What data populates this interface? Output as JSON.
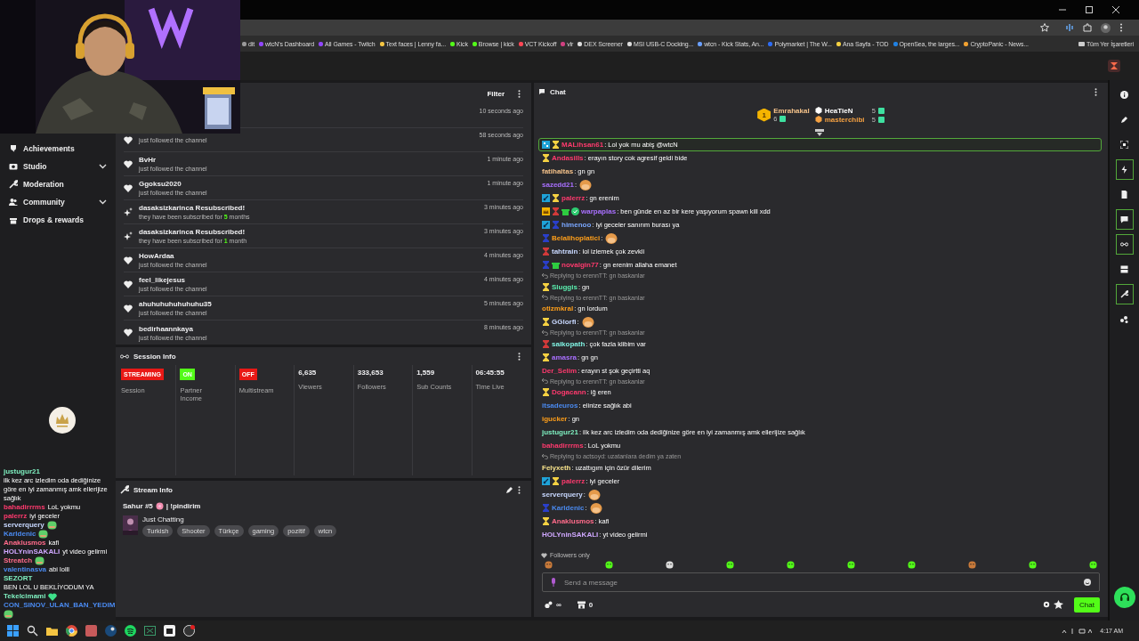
{
  "browser": {
    "bookmarks": [
      {
        "label": "dit",
        "color": "#9a9a9a"
      },
      {
        "label": "wtcN's Dashboard",
        "color": "#9146ff"
      },
      {
        "label": "All Games - Twitch",
        "color": "#9146ff"
      },
      {
        "label": "Text faces | Lenny fa...",
        "color": "#f5c542"
      },
      {
        "label": "Kick",
        "color": "#53fc18"
      },
      {
        "label": "Browse | kick",
        "color": "#53fc18"
      },
      {
        "label": "VCT Kickoff",
        "color": "#ff4655"
      },
      {
        "label": "vlr",
        "color": "#d04080"
      },
      {
        "label": "DEX Screener",
        "color": "#dddddd"
      },
      {
        "label": "MSI USB-C Docking...",
        "color": "#dddddd"
      },
      {
        "label": "wtcn - Kick Stats, An...",
        "color": "#6aa0ff"
      },
      {
        "label": "Polymarket | The W...",
        "color": "#2d6cf5"
      },
      {
        "label": "Ana Sayfa - TOD",
        "color": "#f5d142"
      },
      {
        "label": "OpenSea, the larges...",
        "color": "#2081e2"
      },
      {
        "label": "CryptoPanic - News...",
        "color": "#f0a030"
      }
    ],
    "all_bookmarks": "Tüm Yer İşaretleri"
  },
  "sidebar": {
    "items": [
      {
        "label": "Achievements",
        "kind": "trophy",
        "has_submenu": false
      },
      {
        "label": "Studio",
        "kind": "camera",
        "has_submenu": true
      },
      {
        "label": "Moderation",
        "kind": "wrench",
        "has_submenu": false
      },
      {
        "label": "Community",
        "kind": "people",
        "has_submenu": true
      },
      {
        "label": "Drops & rewards",
        "kind": "gift",
        "has_submenu": false
      }
    ]
  },
  "activity_feed": {
    "filter": "Filter",
    "items": [
      {
        "time": "10 seconds ago"
      },
      {
        "kind": "follow",
        "detail": "just followed the channel",
        "time": "58 seconds ago"
      },
      {
        "kind": "follow",
        "name": "BvHr",
        "detail": "just followed the channel",
        "time": "1 minute ago"
      },
      {
        "kind": "follow",
        "name": "Ggoksu2020",
        "detail": "just followed the channel",
        "time": "1 minute ago"
      },
      {
        "kind": "resub",
        "name": "dasaksizkarinca Resubscribed!",
        "detail": "they have been subscribed for",
        "count": "5",
        "unit": "months",
        "time": "3 minutes ago"
      },
      {
        "kind": "resub",
        "name": "dasaksizkarinca Resubscribed!",
        "detail": "they have been subscribed for",
        "count": "1",
        "unit": "month",
        "time": "3 minutes ago"
      },
      {
        "kind": "follow",
        "name": "HowArdaa",
        "detail": "just followed the channel",
        "time": "4 minutes ago"
      },
      {
        "kind": "follow",
        "name": "feel_likejesus",
        "detail": "just followed the channel",
        "time": "4 minutes ago"
      },
      {
        "kind": "follow",
        "name": "ahuhuhuhuhuhuhu35",
        "detail": "just followed the channel",
        "time": "5 minutes ago"
      },
      {
        "kind": "follow",
        "name": "bedirhaannkaya",
        "detail": "just followed the channel",
        "time": "8 minutes ago"
      }
    ]
  },
  "session_info": {
    "title": "Session Info",
    "cells": [
      {
        "kind": "status",
        "badge": "STREAMING",
        "color": "#e91916",
        "label": "Session"
      },
      {
        "kind": "status",
        "badge": "ON",
        "color": "#53fc18",
        "label": "Partner Income"
      },
      {
        "kind": "status",
        "badge": "OFF",
        "color": "#e91916",
        "label": "Multistream"
      },
      {
        "kind": "stat",
        "value": "6,635",
        "label": "Viewers"
      },
      {
        "kind": "stat",
        "value": "333,653",
        "label": "Followers"
      },
      {
        "kind": "stat",
        "value": "1,559",
        "label": "Sub Counts"
      },
      {
        "kind": "stat",
        "value": "06:45:55",
        "label": "Time Live"
      }
    ]
  },
  "stream_info": {
    "title": "Stream Info",
    "stream_title": "Sahur #5",
    "command": "| !pindirim",
    "category": "Just Chatting",
    "tags": [
      "Turkish",
      "Shooter",
      "Türkçe",
      "gaming",
      "pozitif",
      "wtcn"
    ]
  },
  "chat": {
    "title": "Chat",
    "leaderboard": {
      "top": {
        "rank": "1",
        "user": "Emrahakal",
        "count": "6",
        "color": "#f5c28a"
      },
      "others": [
        {
          "user": "HeaTieN",
          "count": "5",
          "color": "#ffffff"
        },
        {
          "user": "masterchibi",
          "count": "5",
          "color": "#f5a142"
        }
      ]
    },
    "messages": [
      {
        "badges": [
          {
            "kind": "grid"
          },
          {
            "kind": "sub"
          }
        ],
        "user": "MALihsan61",
        "color": "#ff3a6e",
        "kind": "text",
        "text": ": Lol yok mu abiş @wtcN",
        "highlighted": true
      },
      {
        "badges": [
          {
            "kind": "sub"
          }
        ],
        "user": "Andasills",
        "color": "#ff3a6e",
        "kind": "text",
        "text": ": erayın story cok agresif geldi bide",
        "highlighted": false
      },
      {
        "user": "fatihaltas",
        "color": "#f5c28a",
        "kind": "text",
        "text": ": gn gn",
        "highlighted": false
      },
      {
        "user": "sazedd21",
        "color": "#a970ff",
        "kind": "emote",
        "text": ":",
        "highlighted": false
      },
      {
        "badges": [
          {
            "kind": "mod"
          },
          {
            "kind": "sub"
          }
        ],
        "user": "palerrz",
        "color": "#ff3a6e",
        "kind": "text",
        "text": ": gn erenim",
        "highlighted": false
      },
      {
        "badges": [
          {
            "kind": "crown"
          },
          {
            "kind": "sub-red"
          },
          {
            "kind": "gift"
          },
          {
            "kind": "verified"
          }
        ],
        "user": "warpaplas",
        "color": "#a970ff",
        "kind": "text",
        "text": ": ben günde en az bir kere yaşıyorum spawn kill xdd",
        "highlighted": false
      },
      {
        "badges": [
          {
            "kind": "mod"
          },
          {
            "kind": "sub-blue"
          }
        ],
        "user": "himenoo",
        "color": "#7aa7ff",
        "kind": "text",
        "text": ": iyi geceler sanırım burası ya",
        "highlighted": false
      },
      {
        "badges": [
          {
            "kind": "sub-blue"
          }
        ],
        "user": "Belalihoplatici",
        "color": "#ff9f1a",
        "kind": "emote",
        "text": ":",
        "highlighted": false
      },
      {
        "badges": [
          {
            "kind": "sub-red"
          }
        ],
        "user": "tahtrain",
        "color": "#c8d8ff",
        "kind": "text",
        "text": ": lol izlemek çok zevkli",
        "highlighted": false
      },
      {
        "badges": [
          {
            "kind": "sub-blue"
          },
          {
            "kind": "gift"
          }
        ],
        "user": "novalgin77",
        "color": "#ff3a6e",
        "kind": "text",
        "text": ": gn erenim allaha emanet",
        "highlighted": false
      },
      {
        "reply": "Replying to erennTT: gn baskanlar",
        "badges": [
          {
            "kind": "sub"
          }
        ],
        "user": "Sluggis",
        "color": "#5bf0b0",
        "kind": "text",
        "text": ": gn",
        "highlighted": false
      },
      {
        "reply": "Replying to erennTT: gn baskanlar",
        "user": "otizmkral",
        "color": "#ff9f1a",
        "kind": "text",
        "text": ": gn lordum",
        "highlighted": false
      },
      {
        "badges": [
          {
            "kind": "sub"
          }
        ],
        "user": "GGlorfi",
        "color": "#c8d8ff",
        "kind": "emote",
        "text": ":",
        "highlighted": false
      },
      {
        "reply": "Replying to erennTT: gn baskanlar",
        "badges": [
          {
            "kind": "sub-red"
          }
        ],
        "user": "saikopath",
        "color": "#7ff0e0",
        "kind": "text",
        "text": ": çok fazla klibim var",
        "highlighted": false
      },
      {
        "badges": [
          {
            "kind": "sub"
          }
        ],
        "user": "amasra",
        "color": "#a970ff",
        "kind": "text",
        "text": ": gn gn",
        "highlighted": false
      },
      {
        "user": "Der_Selim",
        "color": "#ff3a6e",
        "kind": "text",
        "text": ": erayın st şok geçirtti aq",
        "highlighted": false
      },
      {
        "reply": "Replying to erennTT: gn baskanlar",
        "badges": [
          {
            "kind": "sub"
          }
        ],
        "user": "Dogacann",
        "color": "#ff3a6e",
        "kind": "text",
        "text": ": iğ eren",
        "highlighted": false
      },
      {
        "user": "itsadeuros",
        "color": "#4a8af0",
        "kind": "text",
        "text": ": elinize sağlık abi",
        "highlighted": false
      },
      {
        "user": "igucker",
        "color": "#ff9f1a",
        "kind": "text",
        "text": ": gn",
        "highlighted": false
      },
      {
        "user": "justugur21",
        "color": "#7ff0c0",
        "kind": "text",
        "text": ": ilk kez arc izledim oda dediğinize göre en iyi zamanmış amk ellerijize sağlık",
        "highlighted": false
      },
      {
        "user": "bahadirrrms",
        "color": "#ff3a6e",
        "kind": "text",
        "text": ": LoL yokmu",
        "highlighted": false
      },
      {
        "reply": "Replying to actsoyd: uzatanlara dedim ya zaten",
        "user": "Felyxeth",
        "color": "#f5e08a",
        "kind": "text",
        "text": ": uzattıgım için özür dilerim",
        "highlighted": false
      },
      {
        "badges": [
          {
            "kind": "mod"
          },
          {
            "kind": "sub"
          }
        ],
        "user": "palerrz",
        "color": "#ff3a6e",
        "kind": "text",
        "text": ": iyi geceler",
        "highlighted": false
      },
      {
        "user": "serverquery",
        "color": "#c8d8ff",
        "kind": "emote",
        "text": ":",
        "highlighted": false
      },
      {
        "badges": [
          {
            "kind": "sub-blue"
          }
        ],
        "user": "Karldenic",
        "color": "#4a8af0",
        "kind": "emote",
        "text": ":",
        "highlighted": false
      },
      {
        "badges": [
          {
            "kind": "sub"
          }
        ],
        "user": "Anaklusmos",
        "color": "#ff6b8a",
        "kind": "text",
        "text": ": kafi",
        "highlighted": false
      },
      {
        "user": "HOLYninSAKALI",
        "color": "#d0a8ff",
        "kind": "text",
        "text": ": yt video gelirmi",
        "highlighted": false
      }
    ],
    "mode": "Followers only",
    "placeholder": "Send a message",
    "points": "∞",
    "store_count": "0",
    "send_label": "Chat"
  },
  "rail": [
    {
      "kind": "info",
      "selected": false
    },
    {
      "kind": "pencil",
      "selected": false
    },
    {
      "kind": "frame",
      "selected": false
    },
    {
      "kind": "bolt",
      "selected": true
    },
    {
      "kind": "document",
      "selected": false
    },
    {
      "kind": "chat",
      "selected": true
    },
    {
      "kind": "link",
      "selected": true
    },
    {
      "kind": "layers",
      "selected": false
    },
    {
      "kind": "wrench",
      "selected": true
    },
    {
      "kind": "dots",
      "selected": false
    }
  ],
  "overlay_chat": [
    {
      "user": "justugur21",
      "color": "#7ff0c0",
      "kind": "text",
      "text": "ilk kez arc izledim oda dediğinize göre en iyi zamanmış amk ellerijize sağlık"
    },
    {
      "user": "bahadirrrms",
      "color": "#ff3a6e",
      "kind": "text",
      "text": "LoL yokmu"
    },
    {
      "user": "palerrz",
      "color": "#ff3a6e",
      "kind": "text",
      "text": "iyi geceler"
    },
    {
      "user": "serverquery",
      "color": "#c8d8ff",
      "kind": "emote"
    },
    {
      "user": "Karldenic",
      "color": "#4a8af0",
      "kind": "emote"
    },
    {
      "user": "Anaklusmos",
      "color": "#ff6b8a",
      "kind": "text",
      "text": "kafi"
    },
    {
      "user": "HOLYninSAKALI",
      "color": "#d0a8ff",
      "kind": "text",
      "text": "yt video gelirmi"
    },
    {
      "user": "Streatch",
      "color": "#ff6b8a",
      "kind": "emote"
    },
    {
      "user": "valentinasva",
      "color": "#4a8af0",
      "kind": "text",
      "text": "abi lolll"
    },
    {
      "user": "SEZORT",
      "color": "#7ff0c0",
      "kind": "text",
      "text": "BEN LOL U BEKLİYODUM YA"
    },
    {
      "user": "Tekelcimami",
      "color": "#7ff0c0",
      "kind": "heart"
    },
    {
      "user": "CON_SINOV_ULAN_BAN_YEDIM",
      "color": "#4a8af0",
      "kind": "emote"
    }
  ],
  "taskbar": {
    "time": "4:17 AM"
  }
}
